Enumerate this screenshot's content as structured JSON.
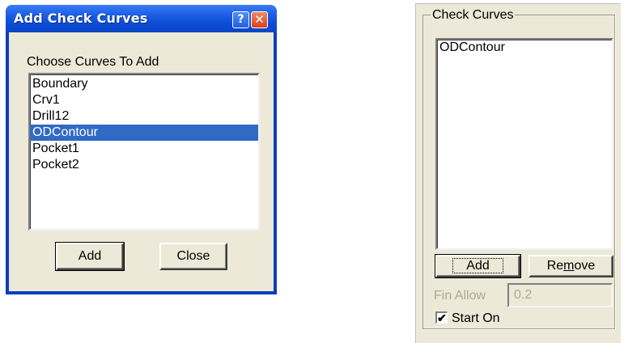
{
  "dialog": {
    "title": "Add Check Curves",
    "help_glyph": "?",
    "close_glyph": "✕",
    "prompt": "Choose Curves To Add",
    "items": [
      "Boundary",
      "Crv1",
      "Drill12",
      "ODContour",
      "Pocket1",
      "Pocket2"
    ],
    "selected_item": "ODContour",
    "add_label": "Add",
    "close_label": "Close"
  },
  "panel": {
    "group_title": "Check Curves",
    "items": [
      "ODContour"
    ],
    "add_label": "Add",
    "remove_label_prefix": "Re",
    "remove_label_accel": "m",
    "remove_label_suffix": "ove",
    "fin_allow_label": "Fin Allow",
    "fin_allow_value": "0.2",
    "start_on_label": "Start On",
    "start_on_checked": true,
    "check_glyph": "✔"
  },
  "colors": {
    "selection": "#316ac5",
    "titlebar": "#0b4cd6",
    "face": "#ece9d8",
    "disabled_text": "#aca899"
  }
}
